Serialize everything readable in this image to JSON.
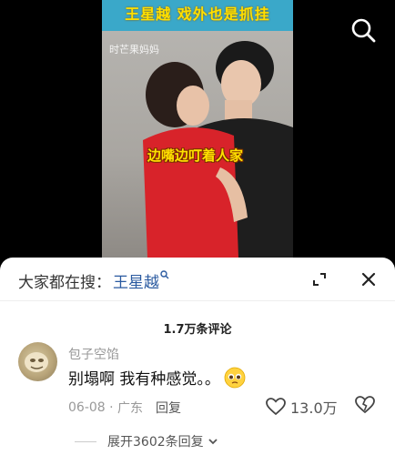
{
  "video": {
    "banner_title": "王星越 戏外也是抓挂",
    "watermark": "时芒果妈妈",
    "caption": "边嘴边叮着人家"
  },
  "icons": {
    "search": "search-icon",
    "expand": "expand-icon",
    "close": "close-icon",
    "like": "heart-icon",
    "dislike": "broken-heart-icon",
    "chevron": "chevron-down-icon"
  },
  "search_bar": {
    "prefix": "大家都在搜：",
    "keyword": "王星越",
    "keyword_icon": "ᵃ"
  },
  "comments_header": {
    "count_label": "1.7万条评论"
  },
  "comment": {
    "username": "包子空馅",
    "text": "别塌啊 我有种感觉。。",
    "date": "06-08",
    "location": "广东",
    "reply_label": "回复",
    "likes": "13.0万"
  },
  "replies": {
    "expand_label": "展开3602条回复"
  },
  "colors": {
    "link_blue": "#2a5aa0",
    "banner_bg": "#3aa8c9",
    "caption_yellow": "#ffe000"
  }
}
